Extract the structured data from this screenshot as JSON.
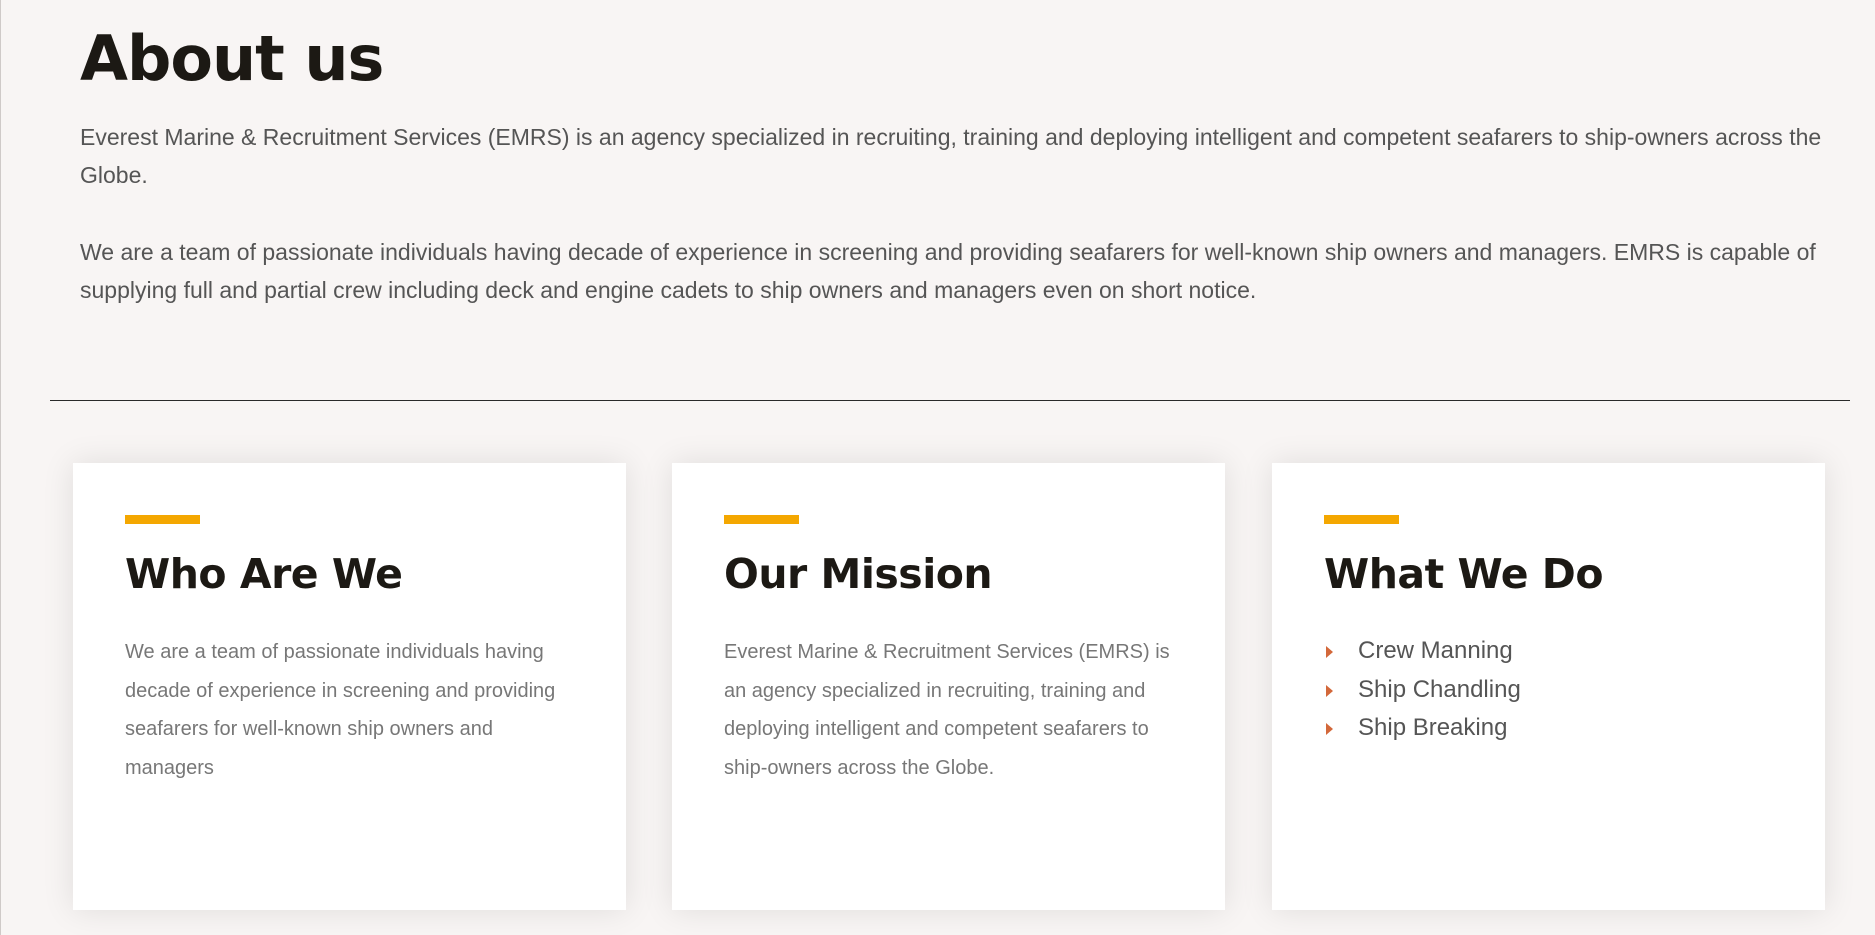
{
  "about": {
    "title": "About us",
    "paragraph_1": "Everest Marine & Recruitment Services (EMRS) is an agency specialized in recruiting, training and deploying intelligent and competent seafarers to ship-owners across the Globe.",
    "paragraph_2": "We are a team of passionate individuals having decade of experience in screening and providing seafarers for well-known ship owners and managers. EMRS is capable of supplying full and partial crew including deck and engine cadets to ship owners and managers even on short notice."
  },
  "cards": [
    {
      "title": "Who Are We",
      "text": "We are a team of passionate individuals having decade of experience in screening and providing seafarers for well-known ship owners and managers"
    },
    {
      "title": "Our Mission",
      "text": "Everest Marine & Recruitment Services (EMRS) is an agency specialized in recruiting, training and deploying intelligent and competent seafarers to ship-owners across the Globe."
    },
    {
      "title": "What We Do",
      "items": [
        "Crew Manning",
        "Ship Chandling",
        "Ship Breaking"
      ]
    }
  ],
  "colors": {
    "accent": "#f4a700",
    "bullet": "#d3683a",
    "heading": "#1c1914",
    "background": "#f8f5f4"
  },
  "icons": {
    "bullet": "caret-right-icon"
  }
}
